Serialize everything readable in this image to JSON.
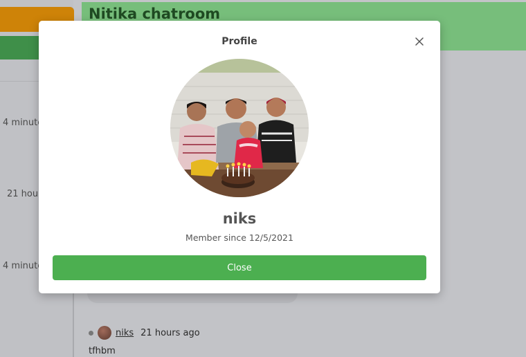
{
  "chat": {
    "title": "Nitika chatroom",
    "message": {
      "username": "niks",
      "time": "21 hours ago",
      "text": "tfhbm"
    }
  },
  "sidebar": {
    "times": [
      "4 minute",
      "21 hour",
      "4 minute"
    ]
  },
  "modal": {
    "title": "Profile",
    "name": "niks",
    "member_since": "Member since 12/5/2021",
    "close_label": "Close"
  },
  "colors": {
    "accent_green": "#4caf50",
    "header_green": "#77be7b",
    "sidebar_orange": "#ce8308"
  },
  "icons": {
    "close": "close-icon",
    "avatar": "profile-photo"
  }
}
